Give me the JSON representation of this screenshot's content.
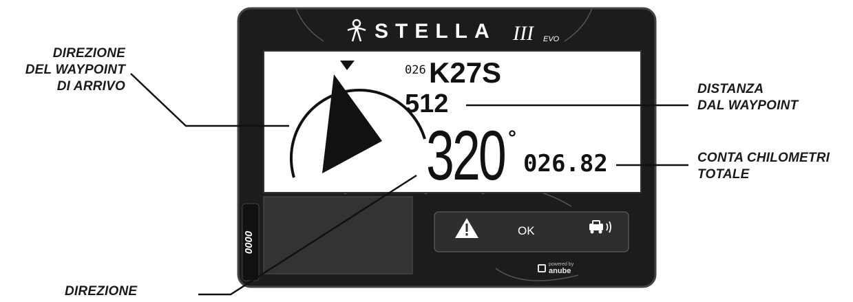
{
  "device": {
    "brand": "STELLA",
    "model_suffix": "III",
    "edition": "EVO",
    "side_counter": "0000",
    "maker_caption": "anube",
    "maker_small": "powered by"
  },
  "display": {
    "waypoint_number": "026",
    "waypoint_code": "K27S",
    "distance": "512",
    "heading_value": "320",
    "heading_unit": "°",
    "odometer": "026.82",
    "compass_icon": "compass-bearing-arrow-icon"
  },
  "buttons": {
    "warning_icon": "warning-triangle-icon",
    "ok_label": "OK",
    "car_icon": "car-horn-icon"
  },
  "callouts": {
    "waypoint_direction": [
      "DIREZIONE",
      "DEL WAYPOINT",
      "DI ARRIVO"
    ],
    "waypoint_distance": [
      "DISTANZA",
      "DAL WAYPOINT"
    ],
    "total_odometer": [
      "CONTA CHILOMETRI",
      "TOTALE"
    ],
    "direction": [
      "DIREZIONE"
    ]
  },
  "colors": {
    "bezel": "#1c1c1c",
    "screen": "#ffffff",
    "panel": "#2e2e2e",
    "callout_text": "#1a1a1a"
  }
}
